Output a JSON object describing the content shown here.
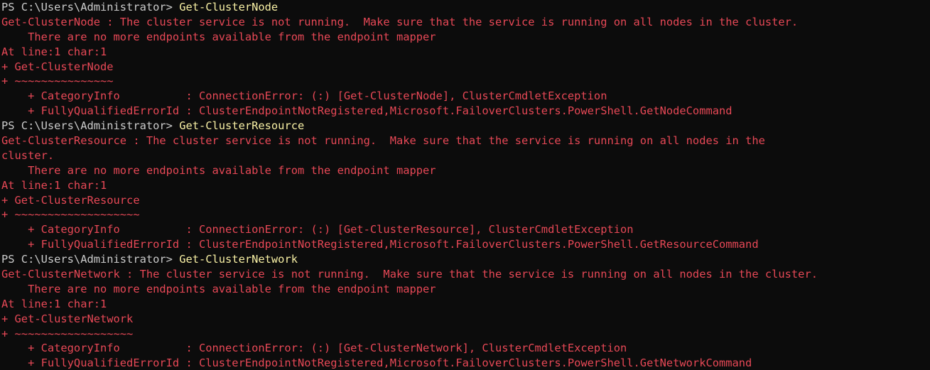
{
  "colors": {
    "background": "#0c0c0c",
    "prompt": "#cccccc",
    "command": "#f9f1a5",
    "error": "#e74856"
  },
  "blocks": [
    {
      "prompt": "PS C:\\Users\\Administrator> ",
      "command": "Get-ClusterNode",
      "errors": [
        "Get-ClusterNode : The cluster service is not running.  Make sure that the service is running on all nodes in the cluster.",
        "    There are no more endpoints available from the endpoint mapper",
        "At line:1 char:1",
        "+ Get-ClusterNode",
        "+ ~~~~~~~~~~~~~~~",
        "    + CategoryInfo          : ConnectionError: (:) [Get-ClusterNode], ClusterCmdletException",
        "    + FullyQualifiedErrorId : ClusterEndpointNotRegistered,Microsoft.FailoverClusters.PowerShell.GetNodeCommand"
      ]
    },
    {
      "prompt": "PS C:\\Users\\Administrator> ",
      "command": "Get-ClusterResource",
      "errors": [
        "Get-ClusterResource : The cluster service is not running.  Make sure that the service is running on all nodes in the",
        "cluster.",
        "    There are no more endpoints available from the endpoint mapper",
        "At line:1 char:1",
        "+ Get-ClusterResource",
        "+ ~~~~~~~~~~~~~~~~~~~",
        "    + CategoryInfo          : ConnectionError: (:) [Get-ClusterResource], ClusterCmdletException",
        "    + FullyQualifiedErrorId : ClusterEndpointNotRegistered,Microsoft.FailoverClusters.PowerShell.GetResourceCommand"
      ]
    },
    {
      "prompt": "PS C:\\Users\\Administrator> ",
      "command": "Get-ClusterNetwork",
      "errors": [
        "Get-ClusterNetwork : The cluster service is not running.  Make sure that the service is running on all nodes in the cluster.",
        "    There are no more endpoints available from the endpoint mapper",
        "At line:1 char:1",
        "+ Get-ClusterNetwork",
        "+ ~~~~~~~~~~~~~~~~~~",
        "    + CategoryInfo          : ConnectionError: (:) [Get-ClusterNetwork], ClusterCmdletException",
        "    + FullyQualifiedErrorId : ClusterEndpointNotRegistered,Microsoft.FailoverClusters.PowerShell.GetNetworkCommand"
      ]
    }
  ]
}
